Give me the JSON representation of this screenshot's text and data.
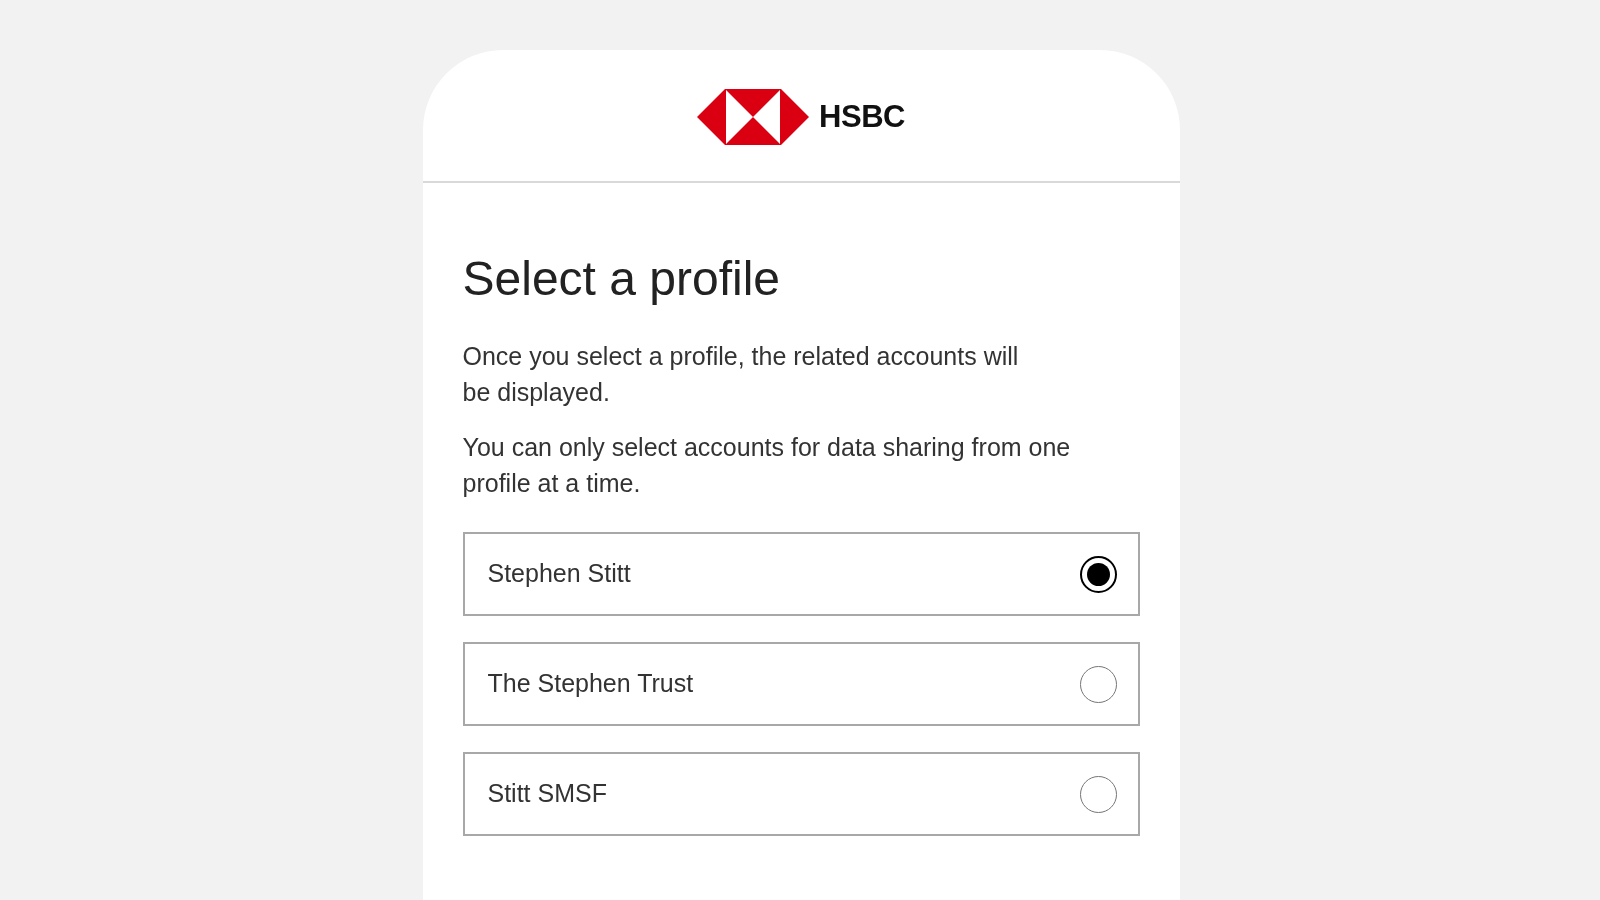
{
  "logo": {
    "wordmark": "HSBC"
  },
  "title": "Select a profile",
  "paragraphs": [
    "Once you select a profile, the related accounts will\nbe displayed.",
    "You can only select accounts for data sharing from one profile at a time."
  ],
  "profiles": [
    {
      "name": "Stephen Stitt",
      "selected": true
    },
    {
      "name": "The Stephen Trust",
      "selected": false
    },
    {
      "name": "Stitt SMSF",
      "selected": false
    }
  ]
}
